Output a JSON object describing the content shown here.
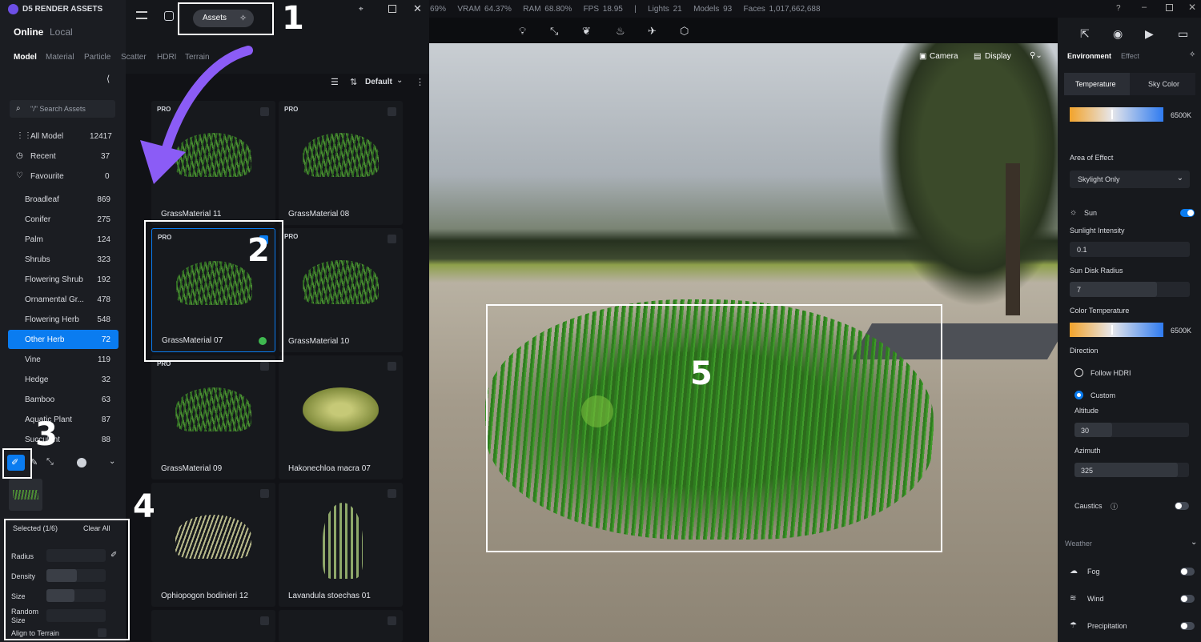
{
  "app": {
    "title": "D5 RENDER ASSETS"
  },
  "stats": {
    "gpu": "69%",
    "vram": "VRAM 64.37%",
    "ram": "RAM 68.80%",
    "fps": "FPS 18.95",
    "sep": "|",
    "lights": "Lights 21",
    "models": "Models 93",
    "faces": "Faces 1,017,662,688"
  },
  "top_tabs": {
    "online": "Online",
    "local": "Local",
    "assets_btn": "Assets"
  },
  "category_tabs": [
    "Model",
    "Material",
    "Particle",
    "Scatter",
    "HDRI",
    "Terrain"
  ],
  "search": {
    "placeholder": "\"/\" Search Assets"
  },
  "sort": {
    "label": "Default"
  },
  "nav": [
    {
      "label": "All Model",
      "count": "12417"
    },
    {
      "label": "Recent",
      "count": "37"
    },
    {
      "label": "Favourite",
      "count": "0"
    }
  ],
  "plants": [
    {
      "label": "Broadleaf",
      "count": "869"
    },
    {
      "label": "Conifer",
      "count": "275"
    },
    {
      "label": "Palm",
      "count": "124"
    },
    {
      "label": "Shrubs",
      "count": "323"
    },
    {
      "label": "Flowering Shrub",
      "count": "192"
    },
    {
      "label": "Ornamental Gr...",
      "count": "478"
    },
    {
      "label": "Flowering Herb",
      "count": "548"
    },
    {
      "label": "Other Herb",
      "count": "72"
    },
    {
      "label": "Vine",
      "count": "119"
    },
    {
      "label": "Hedge",
      "count": "32"
    },
    {
      "label": "Bamboo",
      "count": "63"
    },
    {
      "label": "Aquatic Plant",
      "count": "87"
    },
    {
      "label": "Succulent",
      "count": "88"
    }
  ],
  "assets": [
    {
      "name": "GrassMaterial 11",
      "pro": "PRO"
    },
    {
      "name": "GrassMaterial 08",
      "pro": "PRO"
    },
    {
      "name": "GrassMaterial 07",
      "pro": "PRO"
    },
    {
      "name": "GrassMaterial 10",
      "pro": "PRO"
    },
    {
      "name": "GrassMaterial 09",
      "pro": "PRO"
    },
    {
      "name": "Hakonechloa macra 07",
      "pro": ""
    },
    {
      "name": "Ophiopogon bodinieri 12",
      "pro": ""
    },
    {
      "name": "Lavandula stoechas 01",
      "pro": ""
    }
  ],
  "brush": {
    "selected": "Selected (1/6)",
    "clear": "Clear All",
    "radius": "Radius",
    "density": "Density",
    "size": "Size",
    "random_size": "Random Size",
    "align": "Align to Terrain"
  },
  "view": {
    "camera": "Camera",
    "display": "Display"
  },
  "annotations": [
    "1",
    "2",
    "3",
    "4",
    "5"
  ],
  "env": {
    "tab_env": "Environment",
    "tab_effect": "Effect",
    "temp": "Temperature",
    "sky": "Sky Color",
    "temp_value": "6500K",
    "area_label": "Area of Effect",
    "area_value": "Skylight Only",
    "sun": "Sun",
    "sun_int_label": "Sunlight Intensity",
    "sun_int": "0.1",
    "disk_label": "Sun Disk Radius",
    "disk": "7",
    "ct_label": "Color Temperature",
    "ct_value": "6500K",
    "dir_label": "Direction",
    "follow": "Follow HDRI",
    "custom": "Custom",
    "alt_label": "Altitude",
    "alt": "30",
    "az_label": "Azimuth",
    "az": "325",
    "caustics": "Caustics",
    "weather": "Weather",
    "fog": "Fog",
    "wind": "Wind",
    "precip": "Precipitation"
  },
  "colors": {
    "accent": "#0a7cf0",
    "annotation": "#ffffff",
    "arrow": "#8b5cf6"
  }
}
